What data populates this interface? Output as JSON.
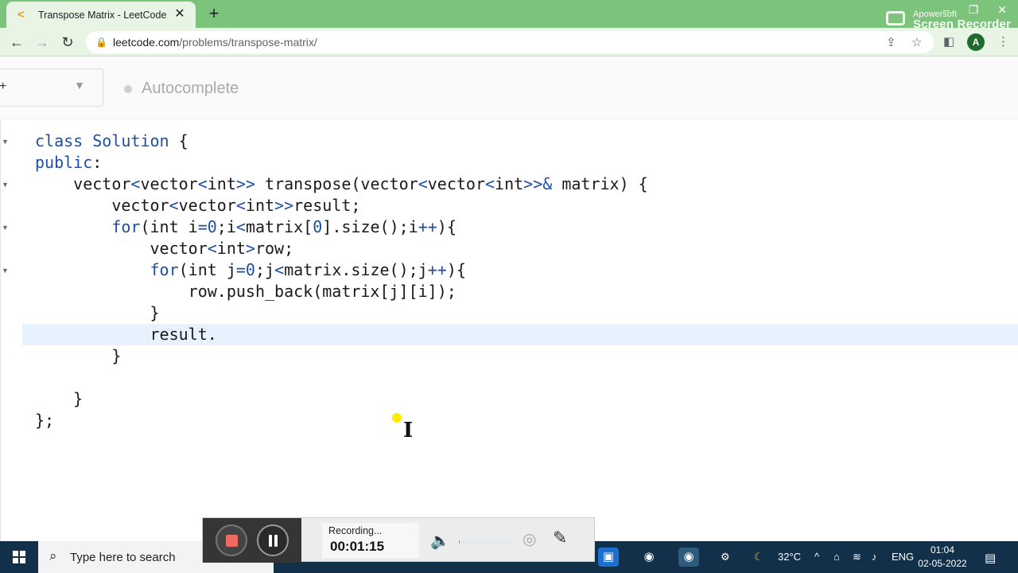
{
  "browser": {
    "tab_title": "Transpose Matrix - LeetCode",
    "tab_favicon": "leetcode-icon",
    "new_tab": "+",
    "url_domain": "leetcode.com",
    "url_path": "/problems/transpose-matrix/",
    "avatar_letter": "A",
    "window_controls": [
      "–",
      "❐",
      "✕"
    ]
  },
  "watermark": {
    "line1": "Apowersoft",
    "line2": "Screen Recorder"
  },
  "editor": {
    "autocomplete_label": "Autocomplete",
    "code_lines": [
      "class Solution {",
      "public:",
      "    vector<vector<int>> transpose(vector<vector<int>>& matrix) {",
      "        vector<vector<int>>result;",
      "        for(int i=0;i<matrix[0].size();i++){",
      "            vector<int>row;",
      "            for(int j=0;j<matrix.size();j++){",
      "                row.push_back(matrix[j][i]);",
      "            }",
      "            result.",
      "        }",
      "",
      "    }",
      "};"
    ],
    "active_line_index": 9
  },
  "recorder": {
    "status": "Recording...",
    "elapsed": "00:01:15",
    "volume_level": 0.02
  },
  "taskbar": {
    "search_placeholder": "Type here to search",
    "temperature": "32°C",
    "language": "ENG",
    "time": "01:04",
    "date": "02-05-2022"
  },
  "colors": {
    "tab_strip": "#7cc47b",
    "toolbar": "#e8f4e4",
    "keyword": "#1e4ea6",
    "active_line": "#e8f2ff",
    "taskbar": "#12304a"
  }
}
